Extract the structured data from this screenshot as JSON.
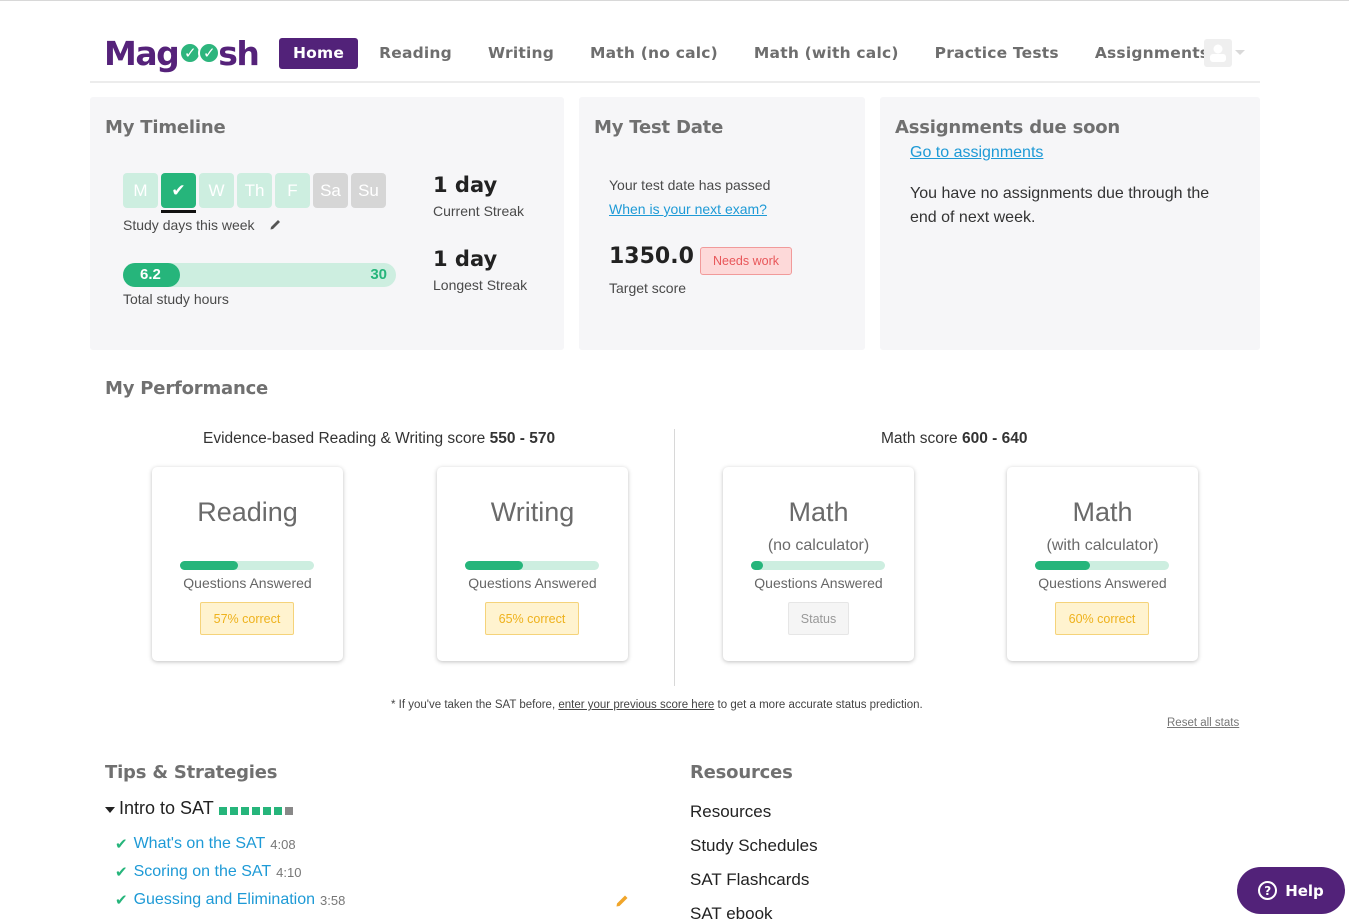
{
  "brand": {
    "logo_text_left": "Mag",
    "logo_text_right": "sh",
    "accent": "#522279",
    "green": "#26b57b"
  },
  "nav": {
    "items": [
      {
        "label": "Home",
        "active": true
      },
      {
        "label": "Reading"
      },
      {
        "label": "Writing"
      },
      {
        "label": "Math (no calc)"
      },
      {
        "label": "Math (with calc)"
      },
      {
        "label": "Practice Tests"
      },
      {
        "label": "Assignments"
      }
    ],
    "user_icon": "user-avatar-icon"
  },
  "timeline": {
    "title": "My Timeline",
    "days": [
      {
        "label": "M",
        "state": "pending"
      },
      {
        "label": "✔",
        "state": "done",
        "today": true
      },
      {
        "label": "W",
        "state": "pending"
      },
      {
        "label": "Th",
        "state": "pending"
      },
      {
        "label": "F",
        "state": "pending"
      },
      {
        "label": "Sa",
        "state": "weekend"
      },
      {
        "label": "Su",
        "state": "weekend"
      }
    ],
    "study_days_label": "Study days this week",
    "hours_value": "6.2",
    "hours_goal": "30",
    "hours_fraction": 0.207,
    "hours_label": "Total study hours",
    "current_streak": "1 day",
    "current_streak_label": "Current Streak",
    "longest_streak": "1 day",
    "longest_streak_label": "Longest Streak"
  },
  "test_date": {
    "title": "My Test Date",
    "status": "Your test date has passed",
    "next_exam_link": "When is your next exam?",
    "target_score": "1350.0",
    "target_badge": "Needs work",
    "target_label": "Target score"
  },
  "assignments": {
    "title": "Assignments due soon",
    "link": "Go to assignments",
    "message": "You have no assignments due through the end of next week."
  },
  "performance": {
    "title": "My Performance",
    "rw_score_label": "Evidence-based Reading & Writing score",
    "rw_score": "550 - 570",
    "math_score_label": "Math score",
    "math_score": "600 - 640",
    "subjects": [
      {
        "name": "Reading",
        "sub": "",
        "answered_fraction": 0.43,
        "answered_label": "Questions Answered",
        "badge": "57% correct",
        "badge_type": "warn"
      },
      {
        "name": "Writing",
        "sub": "",
        "answered_fraction": 0.43,
        "answered_label": "Questions Answered",
        "badge": "65% correct",
        "badge_type": "warn"
      },
      {
        "name": "Math",
        "sub": "(no calculator)",
        "answered_fraction": 0.05,
        "answered_label": "Questions Answered",
        "badge": "Status",
        "badge_type": "neutral"
      },
      {
        "name": "Math",
        "sub": "(with calculator)",
        "answered_fraction": 0.41,
        "answered_label": "Questions Answered",
        "badge": "60% correct",
        "badge_type": "warn"
      }
    ],
    "footnote_pre": "* If you've taken the SAT before,",
    "footnote_link": "enter your previous score here",
    "footnote_post": "to get a more accurate status prediction.",
    "reset_link": "Reset all stats"
  },
  "tips": {
    "title": "Tips & Strategies",
    "group": "Intro to SAT",
    "group_progress": [
      true,
      true,
      true,
      true,
      true,
      true,
      false
    ],
    "lessons": [
      {
        "title": "What's on the SAT",
        "duration": "4:08",
        "done": true
      },
      {
        "title": "Scoring on the SAT",
        "duration": "4:10",
        "done": true
      },
      {
        "title": "Guessing and Elimination",
        "duration": "3:58",
        "done": true
      }
    ]
  },
  "resources": {
    "title": "Resources",
    "items": [
      "Resources",
      "Study Schedules",
      "SAT Flashcards",
      "SAT ebook"
    ]
  },
  "help": {
    "label": "Help"
  }
}
